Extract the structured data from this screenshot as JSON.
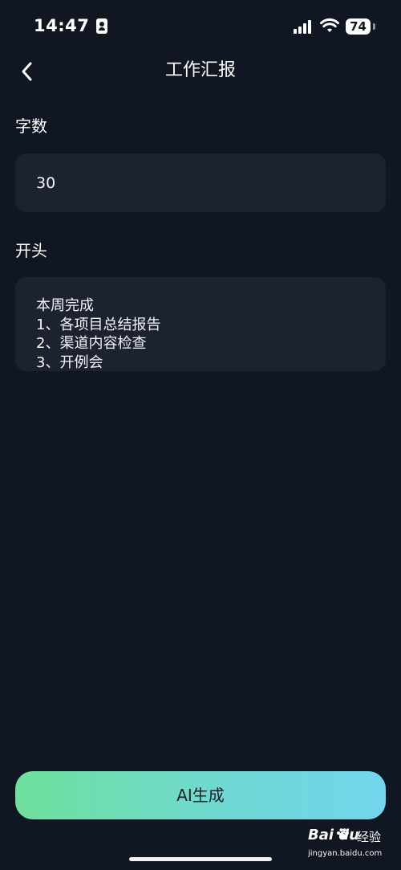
{
  "status_bar": {
    "time": "14:47",
    "battery_level": "74",
    "icons": [
      "id-card-icon",
      "signal-icon",
      "wifi-icon",
      "battery-icon"
    ]
  },
  "header": {
    "title": "工作汇报",
    "back_icon": "chevron-left-icon"
  },
  "form": {
    "word_count": {
      "label": "字数",
      "value": "30"
    },
    "opening": {
      "label": "开头",
      "lines": [
        "本周完成",
        "1、各项目总结报告",
        "2、渠道内容检查",
        "3、开例会"
      ]
    }
  },
  "actions": {
    "generate_label": "AI生成"
  },
  "watermark": {
    "brand": "Bai  du",
    "subtitle": "经验",
    "url": "jingyan.baidu.com"
  },
  "colors": {
    "background": "#111722",
    "field_background": "#1d2230",
    "button_gradient_start": "#6fe09c",
    "button_gradient_end": "#72d5ec"
  }
}
